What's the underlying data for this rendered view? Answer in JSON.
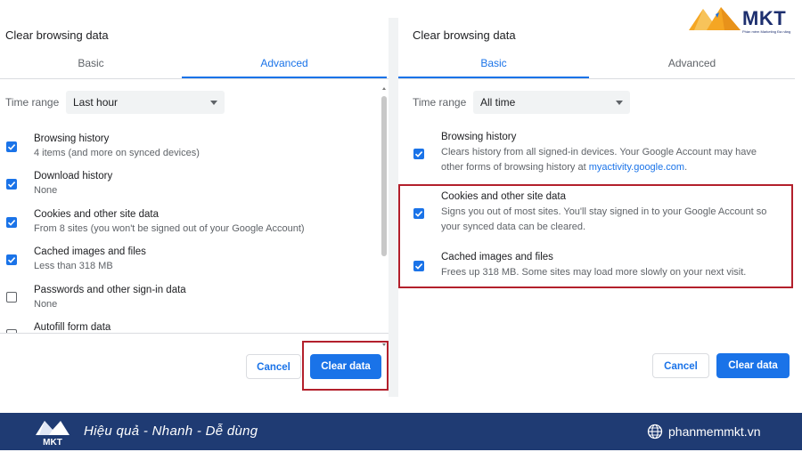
{
  "left": {
    "title": "Clear browsing data",
    "tabs": [
      {
        "label": "Basic"
      },
      {
        "label": "Advanced"
      }
    ],
    "time_range_label": "Time range",
    "time_range_value": "Last hour",
    "items": [
      {
        "title": "Browsing history",
        "desc": "4 items (and more on synced devices)",
        "checked": true
      },
      {
        "title": "Download history",
        "desc": "None",
        "checked": true
      },
      {
        "title": "Cookies and other site data",
        "desc": "From 8 sites (you won't be signed out of your Google Account)",
        "checked": true
      },
      {
        "title": "Cached images and files",
        "desc": "Less than 318 MB",
        "checked": true
      },
      {
        "title": "Passwords and other sign-in data",
        "desc": "None",
        "checked": false
      },
      {
        "title": "Autofill form data",
        "desc": "",
        "checked": false
      }
    ],
    "cancel_label": "Cancel",
    "clear_label": "Clear data"
  },
  "right": {
    "title": "Clear browsing data",
    "tabs": [
      {
        "label": "Basic"
      },
      {
        "label": "Advanced"
      }
    ],
    "time_range_label": "Time range",
    "time_range_value": "All time",
    "items": [
      {
        "title": "Browsing history",
        "desc_line1": "Clears history from all signed-in devices. Your Google Account may have",
        "desc_line2_prefix": "other forms of browsing history at ",
        "desc_link": "myactivity.google.com",
        "desc_line2_suffix": ".",
        "checked": true
      },
      {
        "title": "Cookies and other site data",
        "desc_line1": "Signs you out of most sites. You'll stay signed in to your Google Account so",
        "desc_line2": "your synced data can be cleared.",
        "checked": true
      },
      {
        "title": "Cached images and files",
        "desc_line1": "Frees up 318 MB. Some sites may load more slowly on your next visit.",
        "checked": true
      }
    ],
    "cancel_label": "Cancel",
    "clear_label": "Clear data"
  },
  "brand": {
    "logo_text": "MKT",
    "logo_tagline": "Phần mềm Marketing Đa năng",
    "footer_logo_text": "MKT",
    "slogan": "Hiệu quả - Nhanh - Dễ dùng",
    "website": "phanmemmkt.vn"
  },
  "colors": {
    "accent": "#1a73e8",
    "highlight": "#b3202c",
    "footer_bg": "#1f3b73",
    "brand_orange": "#f5a623",
    "brand_navy": "#1d2f6f"
  }
}
